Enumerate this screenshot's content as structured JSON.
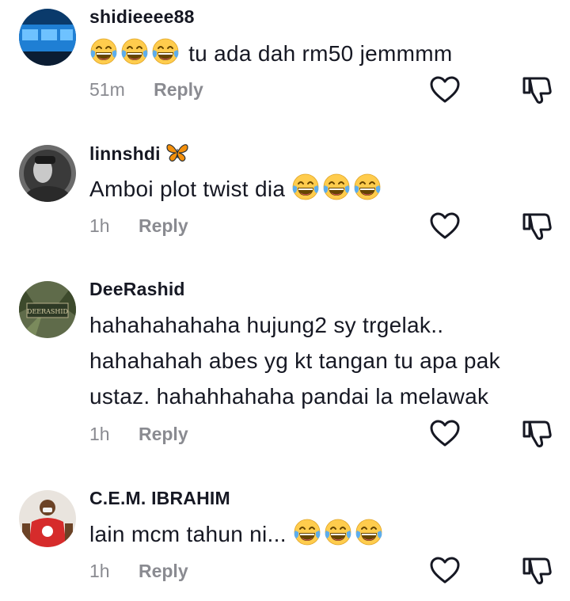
{
  "comments": [
    {
      "username": "shidieeee88",
      "badge": "",
      "text": "tu ada dah rm50 jemmmm",
      "emoji_position": "before",
      "emoji_count": 3,
      "time": "51m",
      "reply_label": "Reply",
      "avatar": "blue-bus-photo"
    },
    {
      "username": "linnshdi",
      "badge": "butterfly-icon",
      "text": "Amboi plot twist dia",
      "emoji_position": "after",
      "emoji_count": 3,
      "time": "1h",
      "reply_label": "Reply",
      "avatar": "dark-portrait-photo"
    },
    {
      "username": "DeeRashid",
      "badge": "",
      "text_lines": [
        "hahahahahaha hujung2 sy trgelak..",
        "hahahahah abes yg kt tangan tu apa pak",
        "ustaz. hahahhahaha pandai la melawak"
      ],
      "time": "1h",
      "reply_label": "Reply",
      "avatar": "deerashid-sign-photo"
    },
    {
      "username": "C.E.M. IBRAHIM",
      "badge": "",
      "text": "lain mcm tahun ni...",
      "emoji_position": "after",
      "emoji_count": 3,
      "time": "1h",
      "reply_label": "Reply",
      "avatar": "man-red-shirt-photo"
    }
  ],
  "icons": {
    "like": "heart-outline-icon",
    "dislike": "thumbs-down-outline-icon",
    "emoji": "face-with-tears-of-joy-icon"
  },
  "colors": {
    "text": "#161823",
    "secondary": "#8a8b91",
    "icon": "#161823"
  }
}
